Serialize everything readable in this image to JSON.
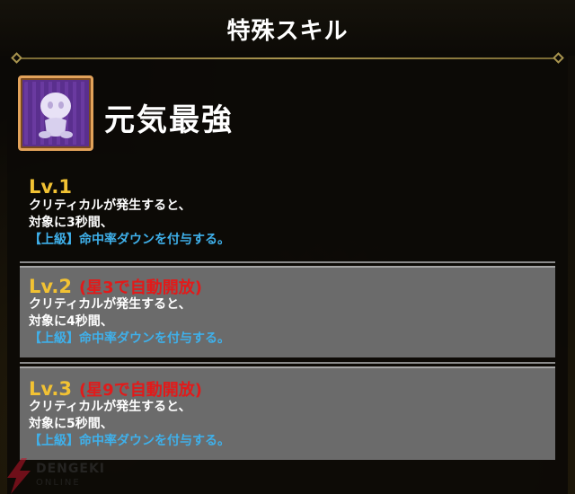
{
  "header": {
    "title": "特殊スキル"
  },
  "skill": {
    "name": "元気最強",
    "icon": "chibi-figure-icon"
  },
  "levels": [
    {
      "label": "Lv.1",
      "unlock": "",
      "line1": "クリティカルが発生すると、",
      "line2": "対象に3秒間、",
      "line3": "【上級】命中率ダウンを付与する。"
    },
    {
      "label": "Lv.2",
      "unlock": "(星3で自動開放)",
      "line1": "クリティカルが発生すると、",
      "line2": "対象に4秒間、",
      "line3": "【上級】命中率ダウンを付与する。"
    },
    {
      "label": "Lv.3",
      "unlock": "(星9で自動開放)",
      "line1": "クリティカルが発生すると、",
      "line2": "対象に5秒間、",
      "line3": "【上級】命中率ダウンを付与する。"
    }
  ],
  "watermark": {
    "brand": "DENGEKI",
    "sub": "ONLINE"
  },
  "colors": {
    "level_label": "#f2c233",
    "unlock_text": "#e21a1a",
    "debuff_text": "#3fb0ea",
    "icon_border": "#e2a25a"
  }
}
